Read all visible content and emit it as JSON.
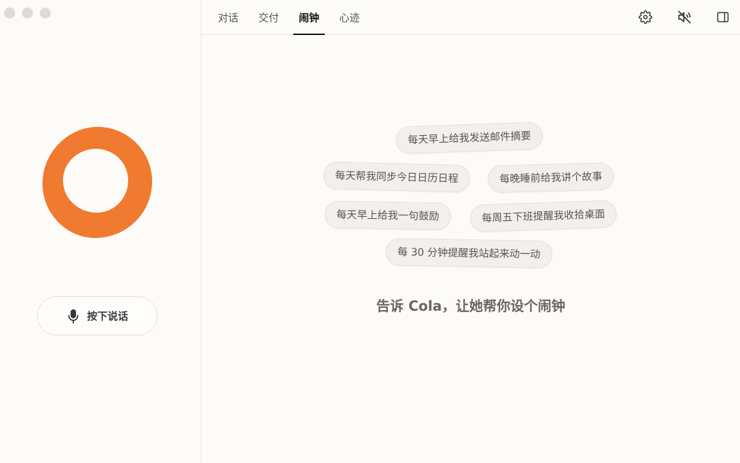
{
  "tabs": [
    {
      "label": "对话"
    },
    {
      "label": "交付"
    },
    {
      "label": "闹钟",
      "active": true
    },
    {
      "label": "心迹"
    }
  ],
  "toolbar": {
    "icons": [
      "gear-icon",
      "speaker-muted-icon",
      "sidebar-toggle-icon"
    ]
  },
  "talk_button": {
    "label": "按下说话",
    "icon": "microphone-icon"
  },
  "suggestions": [
    "每天早上给我发送邮件摘要",
    "每天帮我同步今日日历日程",
    "每晚睡前给我讲个故事",
    "每天早上给我一句鼓励",
    "每周五下班提醒我收拾桌面",
    "每 30 分钟提醒我站起来动一动"
  ],
  "prompt": "告诉 Cola，让她帮你设个闹钟",
  "colors": {
    "accent": "#F07A2F",
    "background": "#FDFBF8",
    "chip_background": "#F3F0EC"
  }
}
